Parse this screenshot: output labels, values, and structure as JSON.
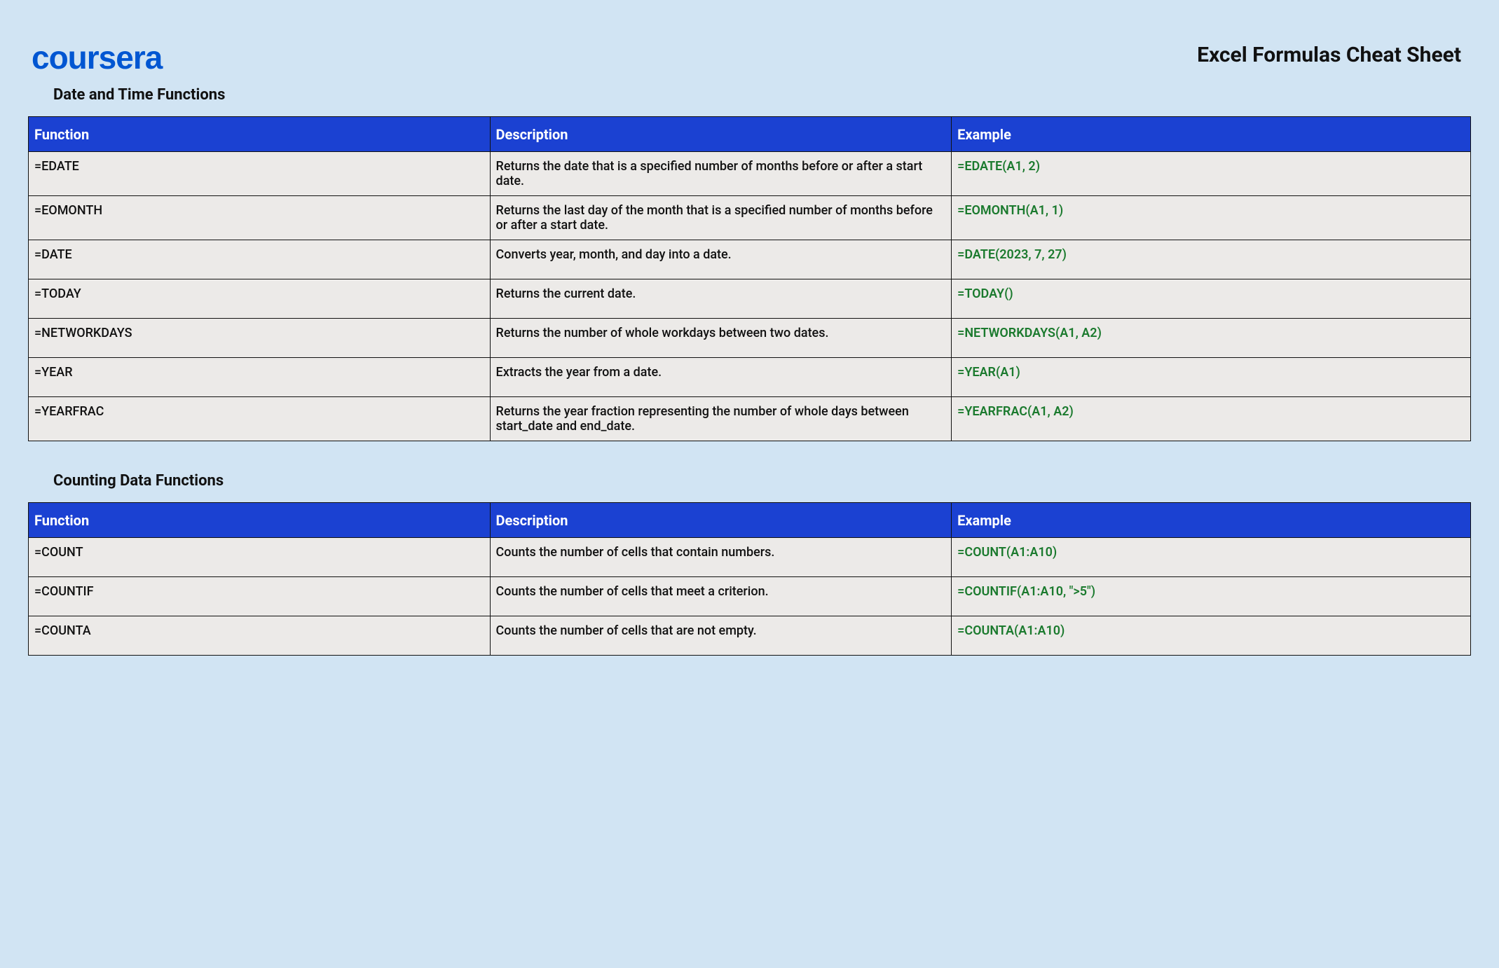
{
  "logo_text": "coursera",
  "page_title": "Excel Formulas Cheat Sheet",
  "columns": {
    "c1": "Function",
    "c2": "Description",
    "c3": "Example"
  },
  "sections": [
    {
      "title": "Date and Time Functions",
      "rows": [
        {
          "fn": "=EDATE",
          "desc": "Returns the date that is a specified number of months before or after a start date.",
          "ex": "=EDATE(A1, 2)"
        },
        {
          "fn": "=EOMONTH",
          "desc": "Returns the last day of the month that is a specified number of months before or after a start date.",
          "ex": "=EOMONTH(A1, 1)"
        },
        {
          "fn": "=DATE",
          "desc": "Converts year, month, and day into a date.",
          "ex": "=DATE(2023, 7, 27)"
        },
        {
          "fn": "=TODAY",
          "desc": "Returns the current date.",
          "ex": "=TODAY()"
        },
        {
          "fn": "=NETWORKDAYS",
          "desc": "Returns the number of whole workdays between two dates.",
          "ex": "=NETWORKDAYS(A1, A2)"
        },
        {
          "fn": "=YEAR",
          "desc": "Extracts the year from a date.",
          "ex": "=YEAR(A1)"
        },
        {
          "fn": "=YEARFRAC",
          "desc": "Returns the year fraction representing the number of whole days between start_date and end_date.",
          "ex": "=YEARFRAC(A1, A2)"
        }
      ]
    },
    {
      "title": "Counting Data Functions",
      "rows": [
        {
          "fn": "=COUNT",
          "desc": "Counts the number of cells that contain numbers.",
          "ex": "=COUNT(A1:A10)"
        },
        {
          "fn": "=COUNTIF",
          "desc": "Counts the number of cells that meet a criterion.",
          "ex": "=COUNTIF(A1:A10, \">5\")"
        },
        {
          "fn": "=COUNTA",
          "desc": "Counts the number of cells that are not empty.",
          "ex": "=COUNTA(A1:A10)"
        }
      ]
    }
  ]
}
